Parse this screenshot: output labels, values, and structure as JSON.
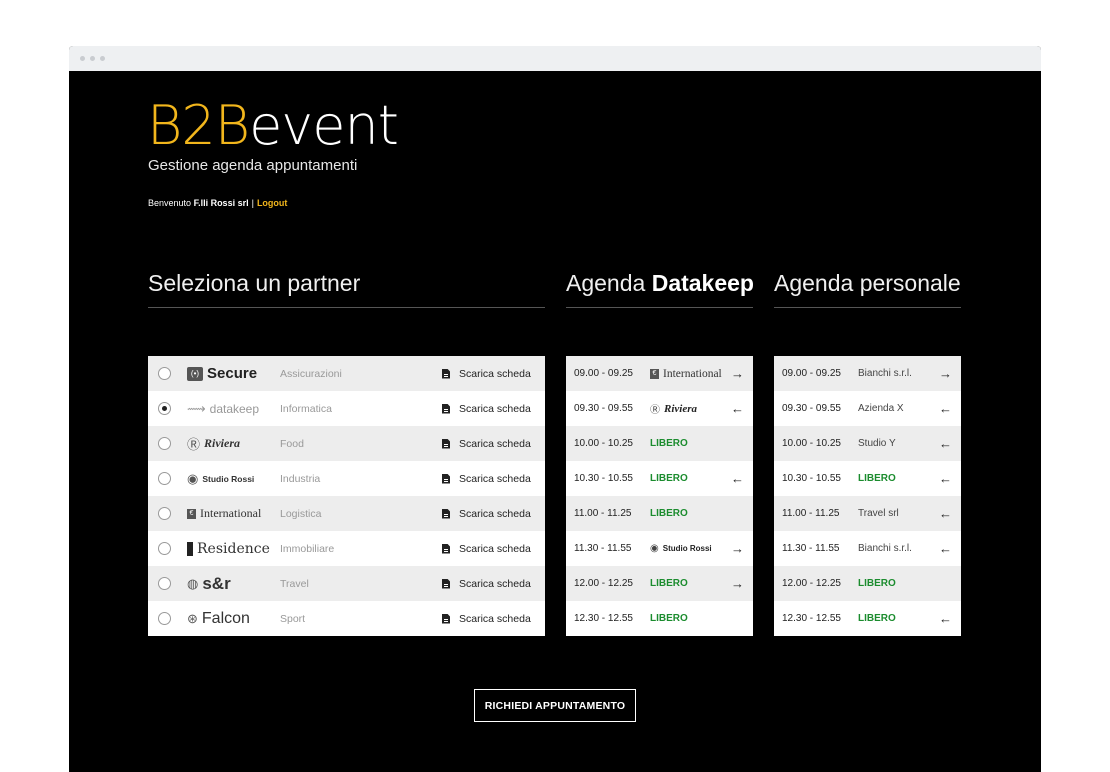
{
  "brand": {
    "b2b": "B2B",
    "event": "event",
    "tagline": "Gestione agenda appuntamenti",
    "accent": "#f2b61c"
  },
  "welcome": {
    "prefix": "Benvenuto",
    "user": "F.lli Rossi srl",
    "separator": "|",
    "logout": "Logout"
  },
  "sections": {
    "partner": "Seleziona un partner",
    "agenda_prefix": "Agenda",
    "agenda_partner": "Datakeep",
    "personal": "Agenda personale"
  },
  "partners": [
    {
      "logo_mark": "(•)",
      "logo": "Secure",
      "category": "Assicurazioni",
      "download": "Scarica scheda",
      "selected": false
    },
    {
      "logo_mark": "⟿",
      "logo": "datakeep",
      "category": "Informatica",
      "download": "Scarica scheda",
      "selected": true
    },
    {
      "logo_mark": "Ⓡ",
      "logo": "Riviera",
      "category": "Food",
      "download": "Scarica scheda",
      "selected": false
    },
    {
      "logo_mark": "◉",
      "logo": "Studio Rossi",
      "category": "Industria",
      "download": "Scarica scheda",
      "selected": false
    },
    {
      "logo_mark": "€",
      "logo": "International",
      "category": "Logistica",
      "download": "Scarica scheda",
      "selected": false
    },
    {
      "logo_mark": "",
      "logo": "Residence",
      "category": "Immobiliare",
      "download": "Scarica scheda",
      "selected": false
    },
    {
      "logo_mark": "◍",
      "logo": "s&r",
      "category": "Travel",
      "download": "Scarica scheda",
      "selected": false
    },
    {
      "logo_mark": "⊛",
      "logo": "Falcon",
      "category": "Sport",
      "download": "Scarica scheda",
      "selected": false
    }
  ],
  "agenda": [
    {
      "time": "09.00 - 09.25",
      "who": "International",
      "kind": "international",
      "arrow": "→"
    },
    {
      "time": "09.30 - 09.55",
      "who": "Riviera",
      "kind": "riviera",
      "arrow": "←"
    },
    {
      "time": "10.00 - 10.25",
      "who": "LIBERO",
      "kind": "free",
      "arrow": ""
    },
    {
      "time": "10.30 - 10.55",
      "who": "LIBERO",
      "kind": "free",
      "arrow": "←"
    },
    {
      "time": "11.00 - 11.25",
      "who": "LIBERO",
      "kind": "free",
      "arrow": ""
    },
    {
      "time": "11.30 - 11.55",
      "who": "Studio Rossi",
      "kind": "studio",
      "arrow": "→"
    },
    {
      "time": "12.00 - 12.25",
      "who": "LIBERO",
      "kind": "free",
      "arrow": "→"
    },
    {
      "time": "12.30 - 12.55",
      "who": "LIBERO",
      "kind": "free",
      "arrow": ""
    }
  ],
  "personal": [
    {
      "time": "09.00 - 09.25",
      "who": "Bianchi s.r.l.",
      "kind": "text",
      "arrow": "→"
    },
    {
      "time": "09.30 - 09.55",
      "who": "Azienda X",
      "kind": "text",
      "arrow": "←"
    },
    {
      "time": "10.00 - 10.25",
      "who": "Studio Y",
      "kind": "text",
      "arrow": "←"
    },
    {
      "time": "10.30 - 10.55",
      "who": "LIBERO",
      "kind": "free",
      "arrow": "←"
    },
    {
      "time": "11.00 - 11.25",
      "who": "Travel srl",
      "kind": "text",
      "arrow": "←"
    },
    {
      "time": "11.30 - 11.55",
      "who": "Bianchi s.r.l.",
      "kind": "text",
      "arrow": "←"
    },
    {
      "time": "12.00 - 12.25",
      "who": "LIBERO",
      "kind": "free",
      "arrow": ""
    },
    {
      "time": "12.30 - 12.55",
      "who": "LIBERO",
      "kind": "free",
      "arrow": "←"
    }
  ],
  "cta": "RICHIEDI APPUNTAMENTO",
  "colors": {
    "free": "#1b8c2e",
    "background": "#000000"
  }
}
